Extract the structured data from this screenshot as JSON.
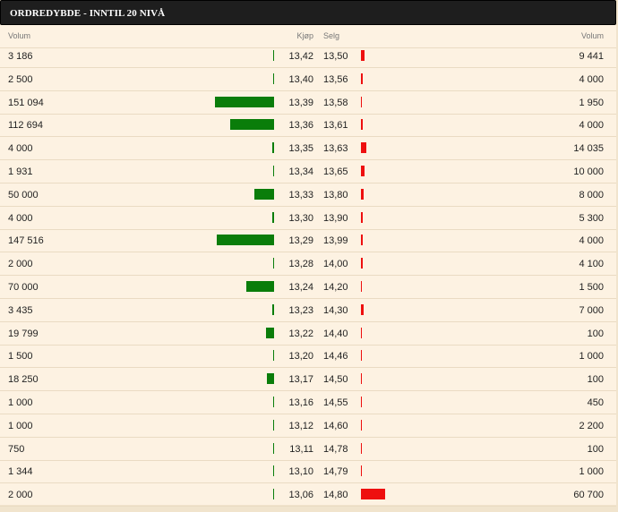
{
  "header": {
    "title": "ORDREDYBDE - INNTIL 20 NIVÅ"
  },
  "columns": {
    "buy_volume": "Volum",
    "bid": "Kjøp",
    "ask": "Selg",
    "sell_volume": "Volum"
  },
  "colors": {
    "buy_bar": "#0a7d0a",
    "sell_bar": "#ee0f0f",
    "header_bg": "#1e1e1e",
    "row_bg": "#fdf2e2"
  },
  "rows": [
    {
      "bvol": "3 186",
      "bid": "13,42",
      "ask": "13,50",
      "svol": "9 441",
      "bv": 3186,
      "sv": 9441
    },
    {
      "bvol": "2 500",
      "bid": "13,40",
      "ask": "13,56",
      "svol": "4 000",
      "bv": 2500,
      "sv": 4000
    },
    {
      "bvol": "151 094",
      "bid": "13,39",
      "ask": "13,58",
      "svol": "1 950",
      "bv": 151094,
      "sv": 1950
    },
    {
      "bvol": "112 694",
      "bid": "13,36",
      "ask": "13,61",
      "svol": "4 000",
      "bv": 112694,
      "sv": 4000
    },
    {
      "bvol": "4 000",
      "bid": "13,35",
      "ask": "13,63",
      "svol": "14 035",
      "bv": 4000,
      "sv": 14035
    },
    {
      "bvol": "1 931",
      "bid": "13,34",
      "ask": "13,65",
      "svol": "10 000",
      "bv": 1931,
      "sv": 10000
    },
    {
      "bvol": "50 000",
      "bid": "13,33",
      "ask": "13,80",
      "svol": "8 000",
      "bv": 50000,
      "sv": 8000
    },
    {
      "bvol": "4 000",
      "bid": "13,30",
      "ask": "13,90",
      "svol": "5 300",
      "bv": 4000,
      "sv": 5300
    },
    {
      "bvol": "147 516",
      "bid": "13,29",
      "ask": "13,99",
      "svol": "4 000",
      "bv": 147516,
      "sv": 4000
    },
    {
      "bvol": "2 000",
      "bid": "13,28",
      "ask": "14,00",
      "svol": "4 100",
      "bv": 2000,
      "sv": 4100
    },
    {
      "bvol": "70 000",
      "bid": "13,24",
      "ask": "14,20",
      "svol": "1 500",
      "bv": 70000,
      "sv": 1500
    },
    {
      "bvol": "3 435",
      "bid": "13,23",
      "ask": "14,30",
      "svol": "7 000",
      "bv": 3435,
      "sv": 7000
    },
    {
      "bvol": "19 799",
      "bid": "13,22",
      "ask": "14,40",
      "svol": "100",
      "bv": 19799,
      "sv": 100
    },
    {
      "bvol": "1 500",
      "bid": "13,20",
      "ask": "14,46",
      "svol": "1 000",
      "bv": 1500,
      "sv": 1000
    },
    {
      "bvol": "18 250",
      "bid": "13,17",
      "ask": "14,50",
      "svol": "100",
      "bv": 18250,
      "sv": 100
    },
    {
      "bvol": "1 000",
      "bid": "13,16",
      "ask": "14,55",
      "svol": "450",
      "bv": 1000,
      "sv": 450
    },
    {
      "bvol": "1 000",
      "bid": "13,12",
      "ask": "14,60",
      "svol": "2 200",
      "bv": 1000,
      "sv": 2200
    },
    {
      "bvol": "750",
      "bid": "13,11",
      "ask": "14,78",
      "svol": "100",
      "bv": 750,
      "sv": 100
    },
    {
      "bvol": "1 344",
      "bid": "13,10",
      "ask": "14,79",
      "svol": "1 000",
      "bv": 1344,
      "sv": 1000
    },
    {
      "bvol": "2 000",
      "bid": "13,06",
      "ask": "14,80",
      "svol": "60 700",
      "bv": 2000,
      "sv": 60700
    }
  ]
}
